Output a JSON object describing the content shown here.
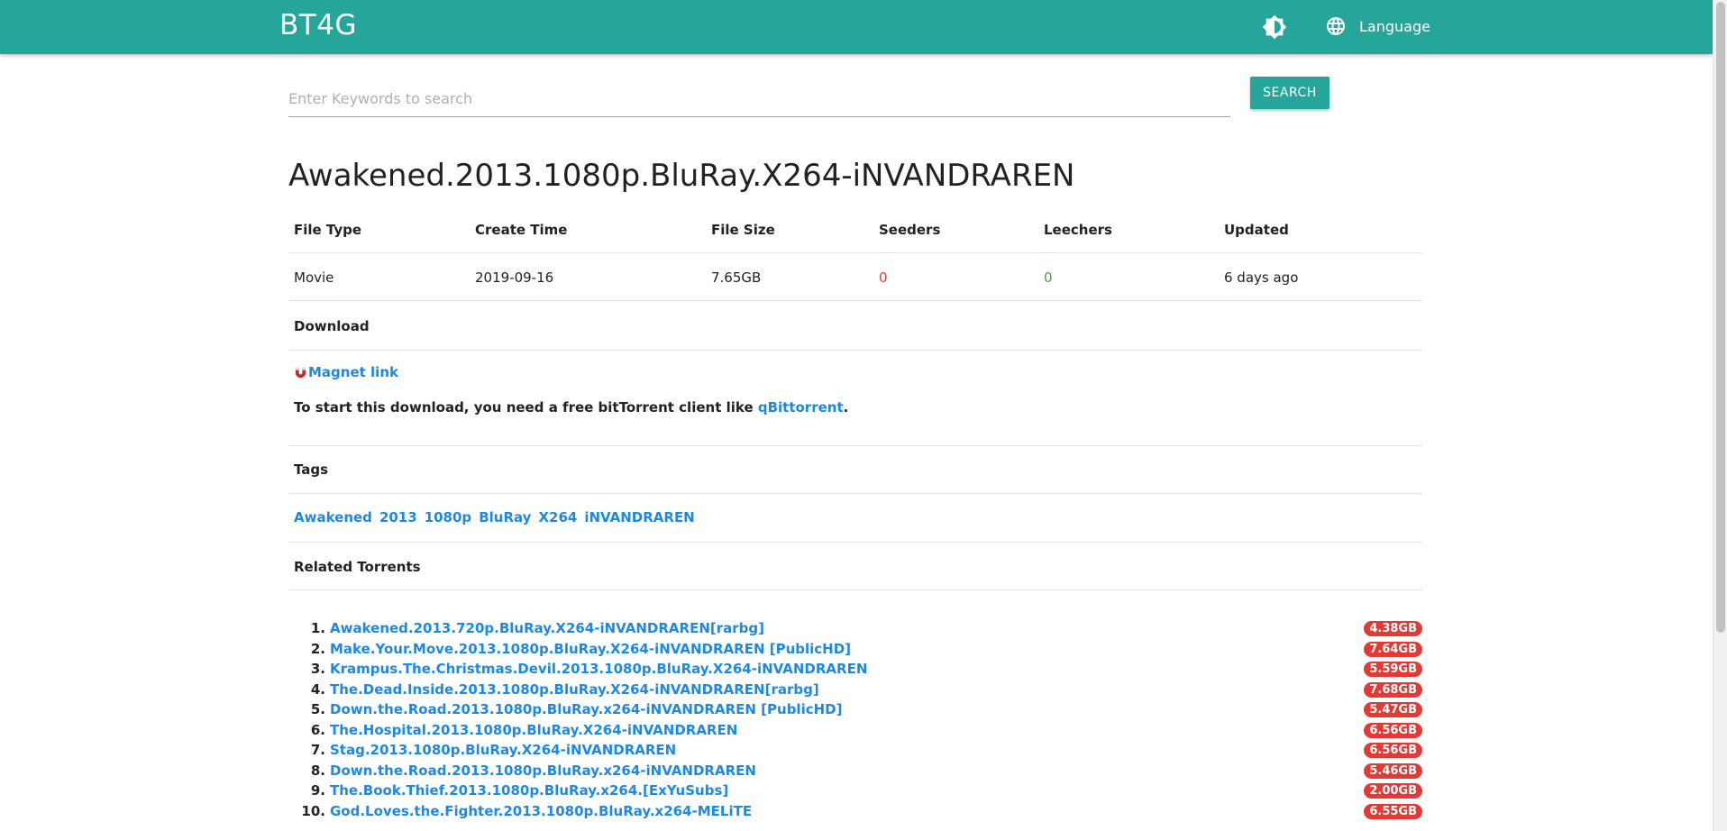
{
  "header": {
    "brand": "BT4G",
    "language_label": "Language"
  },
  "search": {
    "placeholder": "Enter Keywords to search",
    "button_label": "SEARCH"
  },
  "title": "Awakened.2013.1080p.BluRay.X264-iNVANDRAREN",
  "info": {
    "headers": [
      "File Type",
      "Create Time",
      "File Size",
      "Seeders",
      "Leechers",
      "Updated"
    ],
    "values": [
      "Movie",
      "2019-09-16",
      "7.65GB",
      "0",
      "0",
      "6 days ago"
    ],
    "seeders_color": "#e53935",
    "leechers_color": "#43a047"
  },
  "download": {
    "heading": "Download",
    "magnet_label": "Magnet link",
    "hint_prefix": "To start this download, you need a free bitTorrent client like ",
    "client_link": "qBittorrent",
    "hint_suffix": "."
  },
  "tags": {
    "heading": "Tags",
    "items": [
      "Awakened",
      "2013",
      "1080p",
      "BluRay",
      "X264",
      "iNVANDRAREN"
    ]
  },
  "related": {
    "heading": "Related Torrents",
    "items": [
      {
        "num": "1.",
        "name": "Awakened.2013.720p.BluRay.X264-iNVANDRAREN[rarbg]",
        "size": "4.38GB"
      },
      {
        "num": "2.",
        "name": "Make.Your.Move.2013.1080p.BluRay.X264-iNVANDRAREN [PublicHD]",
        "size": "7.64GB"
      },
      {
        "num": "3.",
        "name": "Krampus.The.Christmas.Devil.2013.1080p.BluRay.X264-iNVANDRAREN",
        "size": "5.59GB"
      },
      {
        "num": "4.",
        "name": "The.Dead.Inside.2013.1080p.BluRay.X264-iNVANDRAREN[rarbg]",
        "size": "7.68GB"
      },
      {
        "num": "5.",
        "name": "Down.the.Road.2013.1080p.BluRay.x264-iNVANDRAREN [PublicHD]",
        "size": "5.47GB"
      },
      {
        "num": "6.",
        "name": "The.Hospital.2013.1080p.BluRay.X264-iNVANDRAREN",
        "size": "6.56GB"
      },
      {
        "num": "7.",
        "name": "Stag.2013.1080p.BluRay.X264-iNVANDRAREN",
        "size": "6.56GB"
      },
      {
        "num": "8.",
        "name": "Down.the.Road.2013.1080p.BluRay.x264-iNVANDRAREN",
        "size": "5.46GB"
      },
      {
        "num": "9.",
        "name": "The.Book.Thief.2013.1080p.BluRay.x264.[ExYuSubs]",
        "size": "2.00GB"
      },
      {
        "num": "10.",
        "name": "God.Loves.the.Fighter.2013.1080p.BluRay.x264-MELiTE",
        "size": "6.55GB"
      }
    ]
  },
  "colors": {
    "primary": "#26a69a",
    "link": "#1e88e5",
    "badge": "#e53935"
  }
}
